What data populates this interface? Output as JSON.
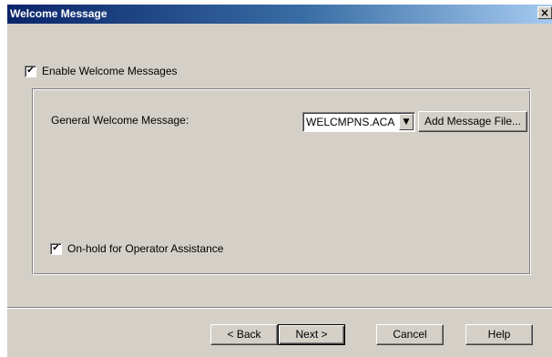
{
  "window": {
    "title": "Welcome Message",
    "close_glyph": "×"
  },
  "options": {
    "enable_welcome": {
      "label": "Enable Welcome Messages",
      "checked": true
    },
    "onhold_operator": {
      "label": "On-hold for Operator Assistance",
      "checked": true
    }
  },
  "general": {
    "label": "General Welcome Message:",
    "selected_value": "WELCMPNS.ACA",
    "add_button_label": "Add Message File..."
  },
  "footer": {
    "back_label": "< Back",
    "next_label": "Next >",
    "cancel_label": "Cancel",
    "help_label": "Help"
  },
  "glyphs": {
    "check": "✔",
    "dropdown": "▼"
  },
  "colors": {
    "title_start": "#0a246a",
    "title_end": "#a6caf0",
    "dialog_bg": "#d4d0c8"
  }
}
